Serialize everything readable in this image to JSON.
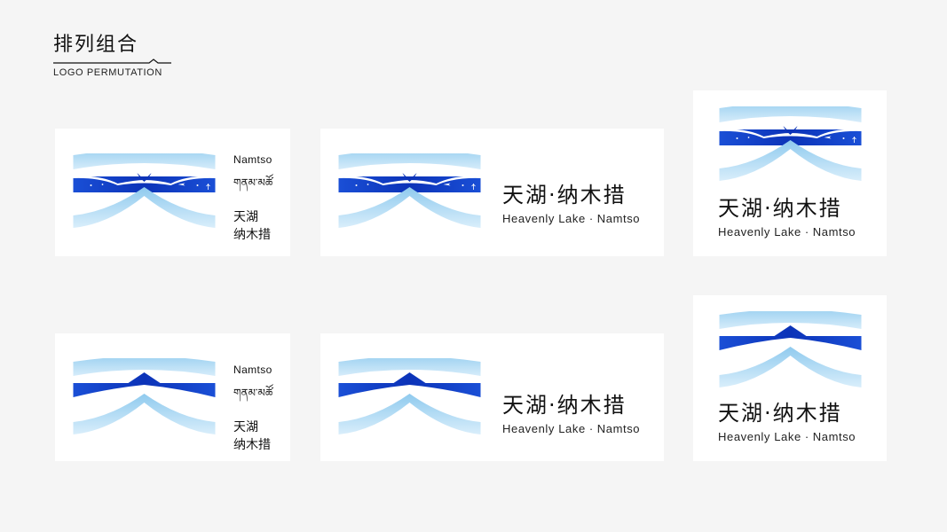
{
  "header": {
    "title_cn": "排列组合",
    "title_en": "LOGO PERMUTATION"
  },
  "brand": {
    "name_en": "Namtso",
    "name_tib": "གནམ་མཚོ",
    "name_cn_part1": "天湖",
    "name_cn_part2": "纳木措",
    "name_cn_full_a": "天湖",
    "name_cn_dot": "·",
    "name_cn_full_b": "纳木措",
    "tagline_a": "Heavenly Lake",
    "tagline_dot": "·",
    "tagline_b": "Namtso"
  },
  "colors": {
    "background": "#f5f5f5",
    "card": "#ffffff",
    "light_blue": "#a9d7f3",
    "pale_blue": "#cfe8f8",
    "deep_blue": "#1140c8"
  },
  "variants": [
    {
      "style": "illustrated",
      "layout": "horizontal-stacked-text"
    },
    {
      "style": "illustrated",
      "layout": "horizontal-text"
    },
    {
      "style": "illustrated",
      "layout": "vertical"
    },
    {
      "style": "simplified",
      "layout": "horizontal-stacked-text"
    },
    {
      "style": "simplified",
      "layout": "horizontal-text"
    },
    {
      "style": "simplified",
      "layout": "vertical"
    }
  ]
}
